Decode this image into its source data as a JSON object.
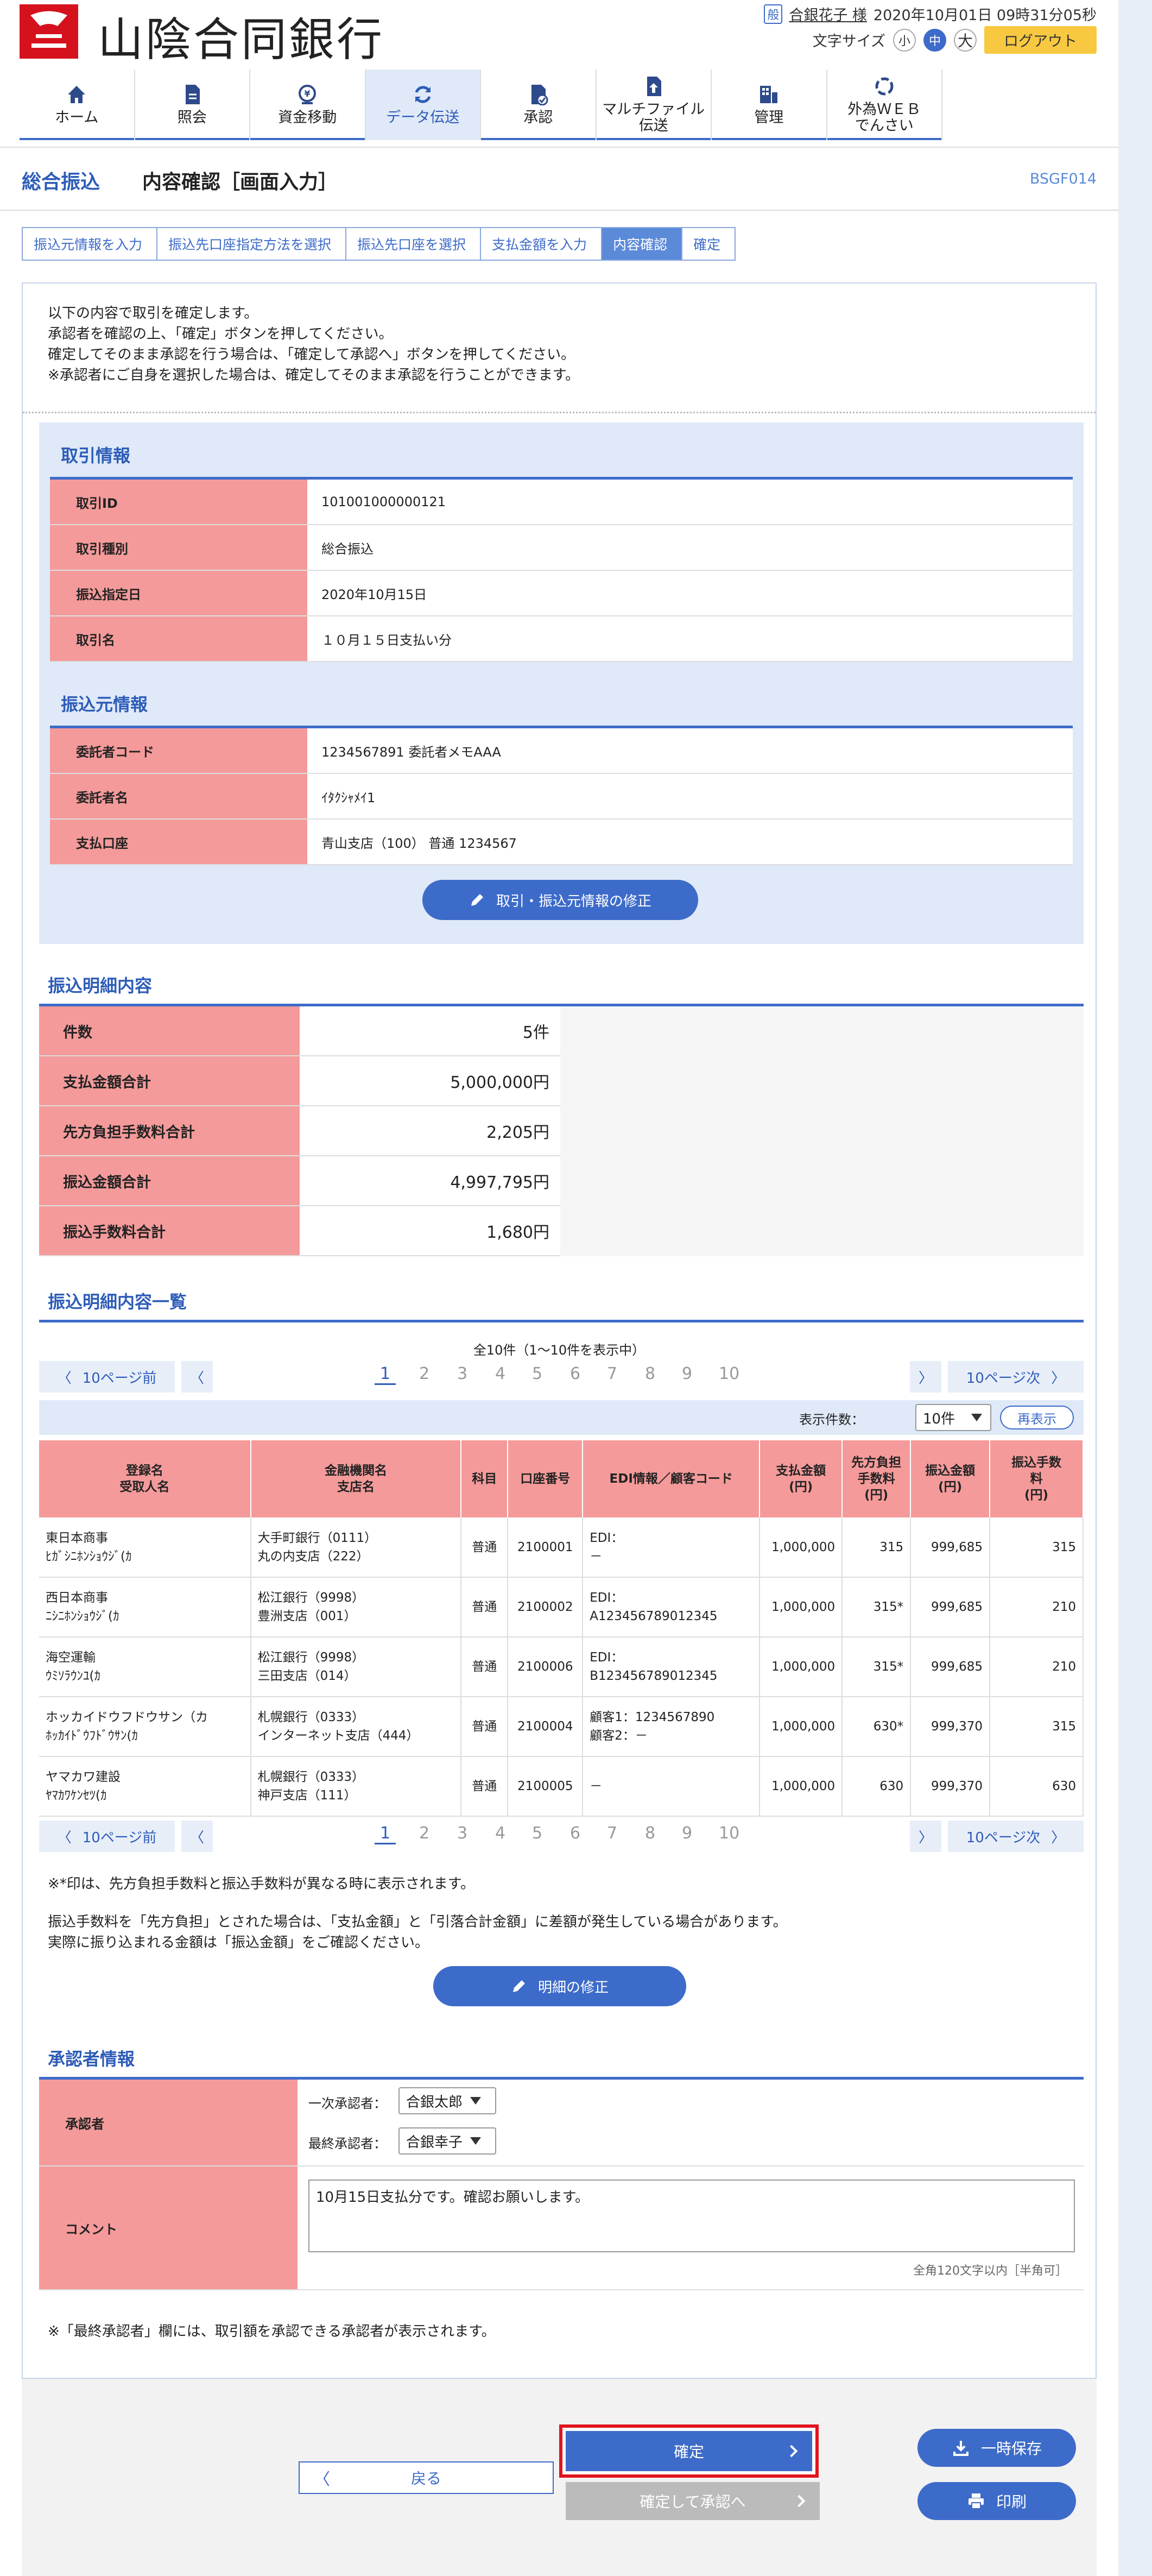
{
  "header": {
    "bank_name": "山陰合同銀行",
    "user_badge": "般",
    "user_name": "合銀花子 様",
    "datetime": "2020年10月01日 09時31分05秒",
    "font_size_label": "文字サイズ",
    "font_small": "小",
    "font_medium": "中",
    "font_large": "大",
    "logout": "ログアウト"
  },
  "nav": [
    {
      "label": "ホーム",
      "icon": "home-icon"
    },
    {
      "label": "照会",
      "icon": "document-icon"
    },
    {
      "label": "資金移動",
      "icon": "yen-transfer-icon"
    },
    {
      "label": "データ伝送",
      "icon": "refresh-icon"
    },
    {
      "label": "承認",
      "icon": "approval-icon"
    },
    {
      "label": "マルチファイル\n伝送",
      "icon": "file-upload-icon"
    },
    {
      "label": "管理",
      "icon": "admin-icon"
    },
    {
      "label": "外為ＷＥＢ\nでんさい",
      "icon": "forex-icon"
    }
  ],
  "title": {
    "category": "総合振込",
    "page": "内容確認［画面入力］",
    "screen_id": "BSGF014"
  },
  "steps": [
    "振込元情報を入力",
    "振込先口座指定方法を選択",
    "振込先口座を選択",
    "支払金額を入力",
    "内容確認",
    "確定"
  ],
  "intro": [
    "以下の内容で取引を確定します。",
    "承認者を確認の上、「確定」ボタンを押してください。",
    "確定してそのまま承認を行う場合は、「確定して承認へ」ボタンを押してください。",
    "※承認者にご自身を選択した場合は、確定してそのまま承認を行うことができます。"
  ],
  "transaction": {
    "title": "取引情報",
    "rows": [
      {
        "k": "取引ID",
        "v": "101001000000121"
      },
      {
        "k": "取引種別",
        "v": "総合振込"
      },
      {
        "k": "振込指定日",
        "v": "2020年10月15日"
      },
      {
        "k": "取引名",
        "v": "１０月１５日支払い分"
      }
    ]
  },
  "source": {
    "title": "振込元情報",
    "rows": [
      {
        "k": "委託者コード",
        "v": "1234567891 委託者メモAAA"
      },
      {
        "k": "委託者名",
        "v": "ｲﾀｸｼｬﾒｲ1"
      },
      {
        "k": "支払口座",
        "v": "青山支店（100） 普通 1234567"
      }
    ],
    "edit_button": "取引・振込元情報の修正"
  },
  "summary": {
    "title": "振込明細内容",
    "rows": [
      {
        "k": "件数",
        "v": "5件"
      },
      {
        "k": "支払金額合計",
        "v": "5,000,000円"
      },
      {
        "k": "先方負担手数料合計",
        "v": "2,205円"
      },
      {
        "k": "振込金額合計",
        "v": "4,997,795円"
      },
      {
        "k": "振込手数料合計",
        "v": "1,680円"
      }
    ]
  },
  "list": {
    "title": "振込明細内容一覧",
    "count_text": "全10件（1～10件を表示中）",
    "prev10": "10ページ前",
    "next10": "10ページ次",
    "pages": [
      "1",
      "2",
      "3",
      "4",
      "5",
      "6",
      "7",
      "8",
      "9",
      "10"
    ],
    "display_label": "表示件数：",
    "display_value": "10件",
    "redisplay": "再表示",
    "headers": [
      "登録名\n受取人名",
      "金融機関名\n支店名",
      "科目",
      "口座番号",
      "EDI情報／顧客コード",
      "支払金額\n(円)",
      "先方負担\n手数料\n(円)",
      "振込金額\n(円)",
      "振込手数\n料\n(円)"
    ],
    "rows": [
      {
        "name": "東日本商事\nﾋｶﾞｼﾆﾎﾝｼｮｳｼﾞ(ｶ",
        "bank": "大手町銀行（0111）\n丸の内支店（222）",
        "type": "普通",
        "acct": "2100001",
        "edi": "EDI：\n－",
        "pay": "1,000,000",
        "fee": "315",
        "amt": "999,685",
        "tfee": "315"
      },
      {
        "name": "西日本商事\nﾆｼﾆﾎﾝｼｮｳｼﾞ(ｶ",
        "bank": "松江銀行（9998）\n豊洲支店（001）",
        "type": "普通",
        "acct": "2100002",
        "edi": "EDI：\nA123456789012345",
        "pay": "1,000,000",
        "fee": "315*",
        "amt": "999,685",
        "tfee": "210"
      },
      {
        "name": "海空運輸\nｳﾐｿﾗｳﾝﾕ(ｶ",
        "bank": "松江銀行（9998）\n三田支店（014）",
        "type": "普通",
        "acct": "2100006",
        "edi": "EDI：\nB123456789012345",
        "pay": "1,000,000",
        "fee": "315*",
        "amt": "999,685",
        "tfee": "210"
      },
      {
        "name": "ホッカイドウフドウサン（カ\nﾎｯｶｲﾄﾞｳﾌﾄﾞｳｻﾝ(ｶ",
        "bank": "札幌銀行（0333）\nインターネット支店（444）",
        "type": "普通",
        "acct": "2100004",
        "edi": "顧客1：1234567890\n顧客2：－",
        "pay": "1,000,000",
        "fee": "630*",
        "amt": "999,370",
        "tfee": "315"
      },
      {
        "name": "ヤマカワ建設\nﾔﾏｶﾜｹﾝｾﾂ(ｶ",
        "bank": "札幌銀行（0333）\n神戸支店（111）",
        "type": "普通",
        "acct": "2100005",
        "edi": "－",
        "pay": "1,000,000",
        "fee": "630",
        "amt": "999,370",
        "tfee": "630"
      }
    ],
    "note1": "※*印は、先方負担手数料と振込手数料が異なる時に表示されます。",
    "note2": "振込手数料を「先方負担」とされた場合は、「支払金額」と「引落合計金額」に差額が発生している場合があります。",
    "note3": "実際に振り込まれる金額は「振込金額」をご確認ください。",
    "edit_button": "明細の修正"
  },
  "approver": {
    "title": "承認者情報",
    "label": "承認者",
    "first_label": "一次承認者：",
    "first_value": "合銀太郎",
    "final_label": "最終承認者：",
    "final_value": "合銀幸子",
    "comment_label": "コメント",
    "comment_value": "10月15日支払分です。確認お願いします。",
    "comment_hint": "全角120文字以内［半角可］",
    "note": "※「最終承認者」欄には、取引額を承認できる承認者が表示されます。"
  },
  "actions": {
    "back": "戻る",
    "confirm": "確定",
    "confirm_approve": "確定して承認へ",
    "save": "一時保存",
    "print": "印刷"
  }
}
